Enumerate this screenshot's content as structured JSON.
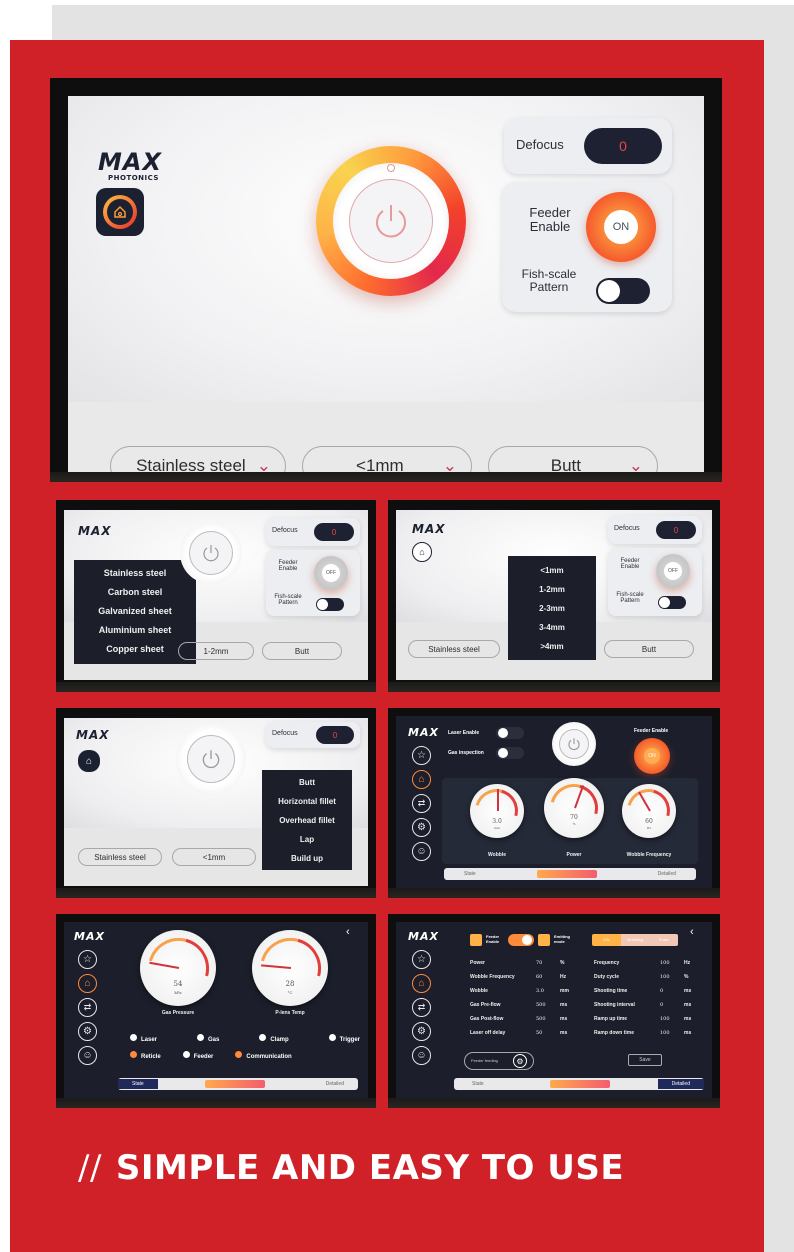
{
  "brand": {
    "logo": "MAX",
    "logo_sub": "PHOTONICS"
  },
  "main_screen": {
    "defocus_label": "Defocus",
    "defocus_value": "0",
    "feeder_enable_label": "Feeder Enable",
    "feeder_state": "ON",
    "fish_scale_label": "Fish-scale Pattern",
    "material": "Stainless steel",
    "thickness": "<1mm",
    "joint": "Butt"
  },
  "thumb1": {
    "menu_items": [
      "Stainless steel",
      "Carbon steel",
      "Galvanized sheet",
      "Aluminium sheet",
      "Copper sheet"
    ],
    "defocus_label": "Defocus",
    "defocus_value": "0",
    "feeder_label": "Feeder Enable",
    "feeder_state": "OFF",
    "fish_label": "Fish-scale Pattern",
    "thickness": "1-2mm",
    "joint": "Butt"
  },
  "thumb2": {
    "menu_items": [
      "<1mm",
      "1-2mm",
      "2-3mm",
      "3-4mm",
      ">4mm"
    ],
    "defocus_label": "Defocus",
    "defocus_value": "0",
    "feeder_label": "Feeder Enable",
    "feeder_state": "OFF",
    "fish_label": "Fish-scale Pattern",
    "material": "Stainless steel",
    "joint": "Butt"
  },
  "thumb3": {
    "menu_items": [
      "Butt",
      "Horizontal fillet",
      "Overhead fillet",
      "Lap",
      "Build up"
    ],
    "defocus_label": "Defocus",
    "defocus_value": "0",
    "material": "Stainless steel",
    "thickness": "<1mm"
  },
  "thumb4": {
    "laser_enable": "Laser Enable",
    "gas_inspection": "Gas inspection",
    "feeder_enable": "Feeder Enable",
    "feeder_state": "ON",
    "gauges": [
      {
        "label": "Wobble",
        "value": "3.0",
        "unit": "mm"
      },
      {
        "label": "Power",
        "value": "70",
        "unit": "%"
      },
      {
        "label": "Wobble Frequency",
        "value": "60",
        "unit": "Hz"
      }
    ],
    "state_label": "State",
    "detailed_label": "Detailed"
  },
  "thumb5": {
    "gauges": [
      {
        "label": "Gas Pressure",
        "value": "54",
        "unit": "kPa"
      },
      {
        "label": "P-lens Temp",
        "value": "28",
        "unit": "°C"
      }
    ],
    "indicators": [
      {
        "label": "Laser",
        "color": "#ffffff"
      },
      {
        "label": "Gas",
        "color": "#ffffff"
      },
      {
        "label": "Clamp",
        "color": "#ffffff"
      },
      {
        "label": "Trigger",
        "color": "#ffffff"
      },
      {
        "label": "Reticle",
        "color": "#ff8a3a"
      },
      {
        "label": "Feeder",
        "color": "#ffffff"
      },
      {
        "label": "Communication",
        "color": "#ff8a3a"
      }
    ],
    "state_label": "State",
    "detailed_label": "Detailed"
  },
  "thumb6": {
    "feeder_enable": "Feeder Enable",
    "emitting_mode": "Emitting mode",
    "mode_tabs": [
      "CW",
      "Wobbling",
      "Pulse"
    ],
    "left_params": [
      {
        "label": "Power",
        "value": "70",
        "unit": "%"
      },
      {
        "label": "Wobble Frequency",
        "value": "60",
        "unit": "Hz"
      },
      {
        "label": "Wobble",
        "value": "3.0",
        "unit": "mm"
      },
      {
        "label": "Gas Pre-flow",
        "value": "500",
        "unit": "ms"
      },
      {
        "label": "Gas Post-flow",
        "value": "500",
        "unit": "ms"
      },
      {
        "label": "Laser off delay",
        "value": "50",
        "unit": "ms"
      }
    ],
    "right_params": [
      {
        "label": "Frequency",
        "value": "100",
        "unit": "Hz"
      },
      {
        "label": "Duty cycle",
        "value": "100",
        "unit": "%"
      },
      {
        "label": "Shooting time",
        "value": "0",
        "unit": "ms"
      },
      {
        "label": "Shooting interval",
        "value": "0",
        "unit": "ms"
      },
      {
        "label": "Ramp up time",
        "value": "100",
        "unit": "ms"
      },
      {
        "label": "Ramp down time",
        "value": "100",
        "unit": "ms"
      }
    ],
    "feeder_feeding": "Feeder feeding",
    "save_label": "Save",
    "state_label": "State",
    "detailed_label": "Detailed"
  },
  "tagline": {
    "slashes": "//",
    "text": "SIMPLE AND EASY TO USE"
  },
  "colors": {
    "red_background": "#cf2127",
    "gray_background": "#e3e3e3",
    "accent_orange": "#ff8a3a",
    "dark_ui": "#1d2131"
  },
  "icons": [
    "home-icon",
    "power-icon",
    "star-icon",
    "settings-icon",
    "gear-icon",
    "user-icon",
    "chevron-down-icon",
    "back-icon"
  ]
}
